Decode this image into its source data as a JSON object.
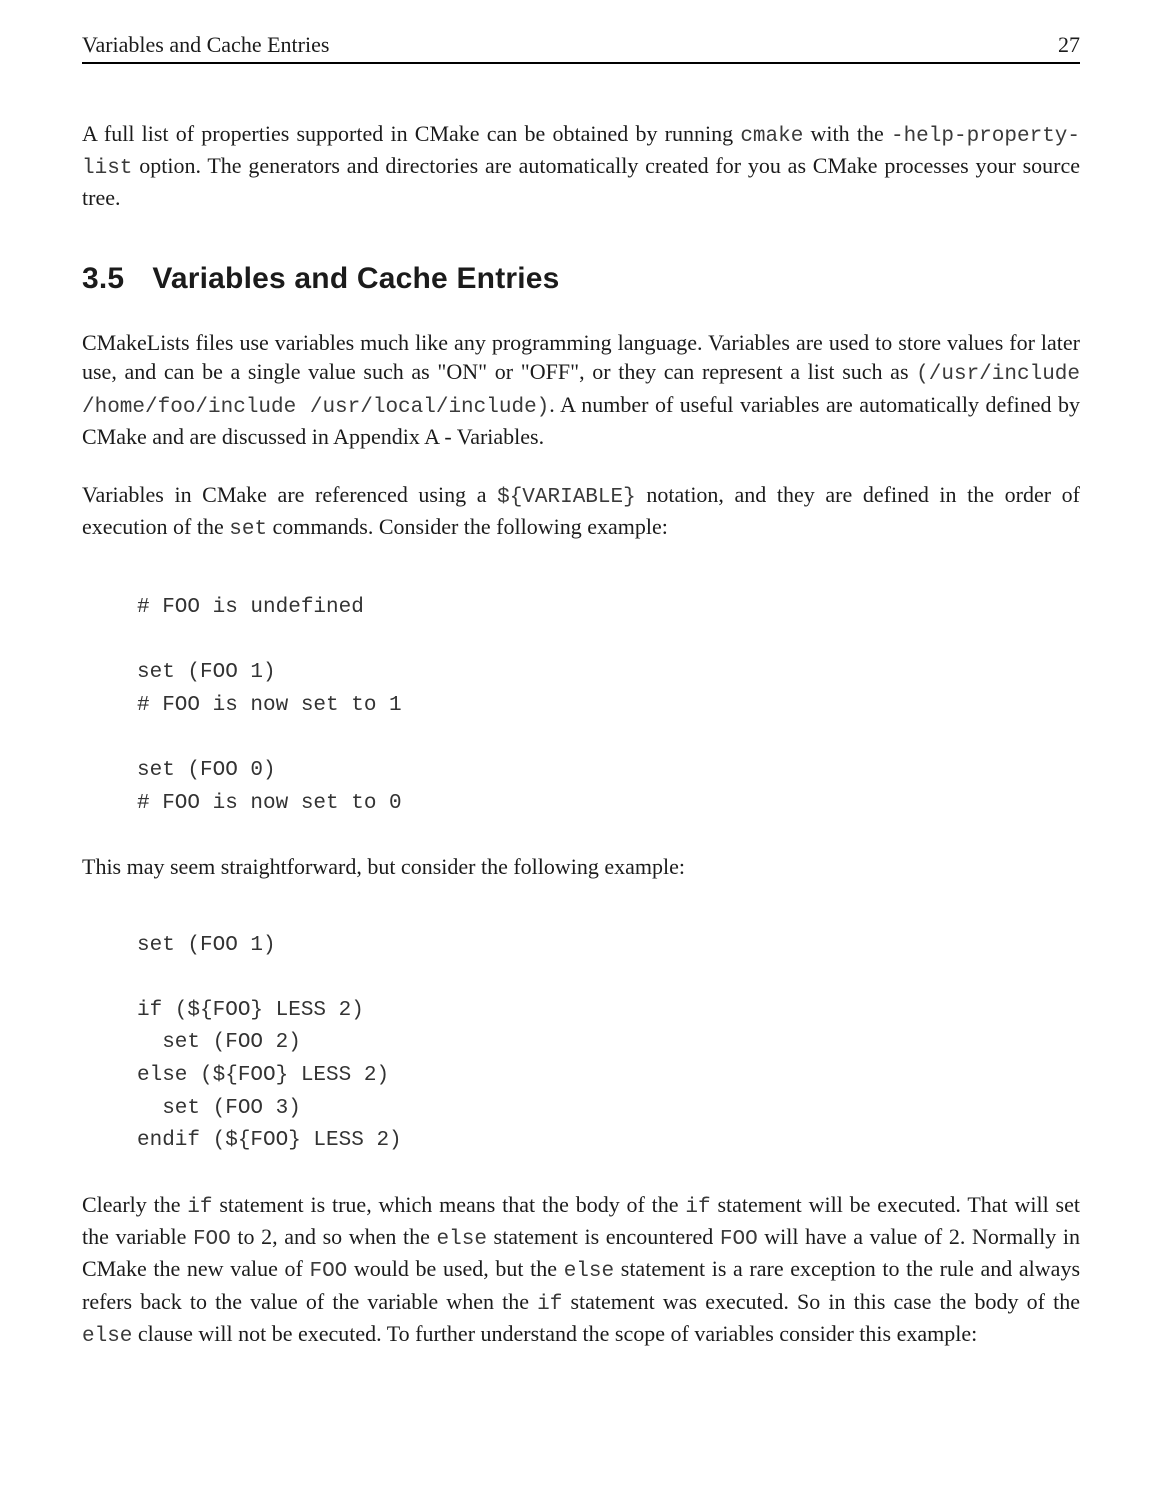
{
  "header": {
    "title": "Variables and Cache Entries",
    "page_number": "27"
  },
  "intro_para": {
    "t1": "A full list of properties supported in CMake can be obtained by running ",
    "c1": "cmake",
    "t2": " with the ",
    "c2": "-help-property-list",
    "t3": " option. The generators and directories are automatically created for you as CMake processes your source tree."
  },
  "section": {
    "number": "3.5",
    "title": "Variables and Cache Entries"
  },
  "p1": {
    "t1": "CMakeLists files use variables much like any programming language. Variables are used to store values for later use, and can be a single value such as \"ON\" or \"OFF\", or they can represent a list such as ",
    "c1": "(/usr/include /home/foo/include /usr/local/include)",
    "t2": ". A number of useful variables are automatically defined by CMake and are discussed in Appendix A - Variables."
  },
  "p2": {
    "t1": "Variables in CMake are referenced using a ",
    "c1": "${VARIABLE}",
    "t2": " notation, and they are defined in the order of execution of the ",
    "c2": "set",
    "t3": " commands. Consider the following example:"
  },
  "code1": "# FOO is undefined\n\nset (FOO 1)\n# FOO is now set to 1\n\nset (FOO 0)\n# FOO is now set to 0",
  "p3": {
    "t1": "This may seem straightforward, but consider the following example:"
  },
  "code2": "set (FOO 1)\n\nif (${FOO} LESS 2)\n  set (FOO 2)\nelse (${FOO} LESS 2)\n  set (FOO 3)\nendif (${FOO} LESS 2)",
  "p4": {
    "t1": "Clearly the ",
    "c1": "if",
    "t2": " statement is true, which means that the body of the ",
    "c2": "if",
    "t3": " statement will be executed. That will set the variable ",
    "c3": "FOO",
    "t4": " to 2, and so when the ",
    "c4": "else",
    "t5": " statement is encountered ",
    "c5": "FOO",
    "t6": " will have a value of 2. Normally in CMake the new value of ",
    "c6": "FOO",
    "t7": " would be used, but the ",
    "c7": "else",
    "t8": " statement is a rare exception to the rule and always refers back to the value of the variable when the ",
    "c8": "if",
    "t9": " statement was executed. So in this case the body of the ",
    "c9": "else",
    "t10": " clause will not be executed. To further understand the scope of variables consider this example:"
  }
}
